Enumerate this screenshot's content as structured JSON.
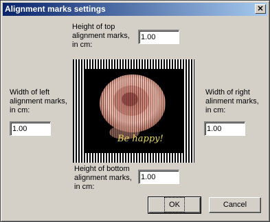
{
  "window": {
    "title": "Alignment marks settings"
  },
  "top": {
    "label_lines": [
      "Height of top",
      "alignment marks,",
      "in cm:"
    ],
    "value": "1.00"
  },
  "left": {
    "label_lines": [
      "Width of left",
      "alignment marks,",
      "in cm:"
    ],
    "value": "1.00"
  },
  "right": {
    "label_lines": [
      "Width of right",
      "alinment marks,",
      "in cm:"
    ],
    "value": "1.00"
  },
  "bottom": {
    "label_lines": [
      "Height of bottom",
      "alignment marks,",
      "in cm:"
    ],
    "value": "1.00"
  },
  "preview": {
    "caption": "Be happy!"
  },
  "buttons": {
    "ok": "OK",
    "cancel": "Cancel"
  }
}
